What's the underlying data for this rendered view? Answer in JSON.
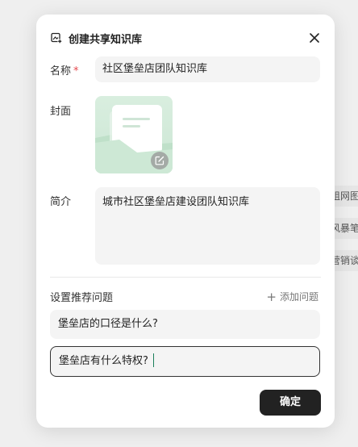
{
  "background": {
    "pills": [
      "组网图",
      "风暴笔",
      "营销谈"
    ]
  },
  "modal": {
    "title": "创建共享知识库",
    "name_label": "名称",
    "required_mark": "*",
    "name_value": "社区堡垒店团队知识库",
    "cover_label": "封面",
    "desc_label": "简介",
    "desc_value": "城市社区堡垒店建设团队知识库",
    "questions_title": "设置推荐问题",
    "add_question_label": "添加问题",
    "questions": [
      "堡垒店的口径是什么?",
      "堡垒店有什么特权?"
    ],
    "confirm_label": "确定"
  },
  "colors": {
    "primary_button": "#222222",
    "required": "#e5484d",
    "cover_bg": "#d4ead9",
    "caret": "#1a7f5a"
  }
}
